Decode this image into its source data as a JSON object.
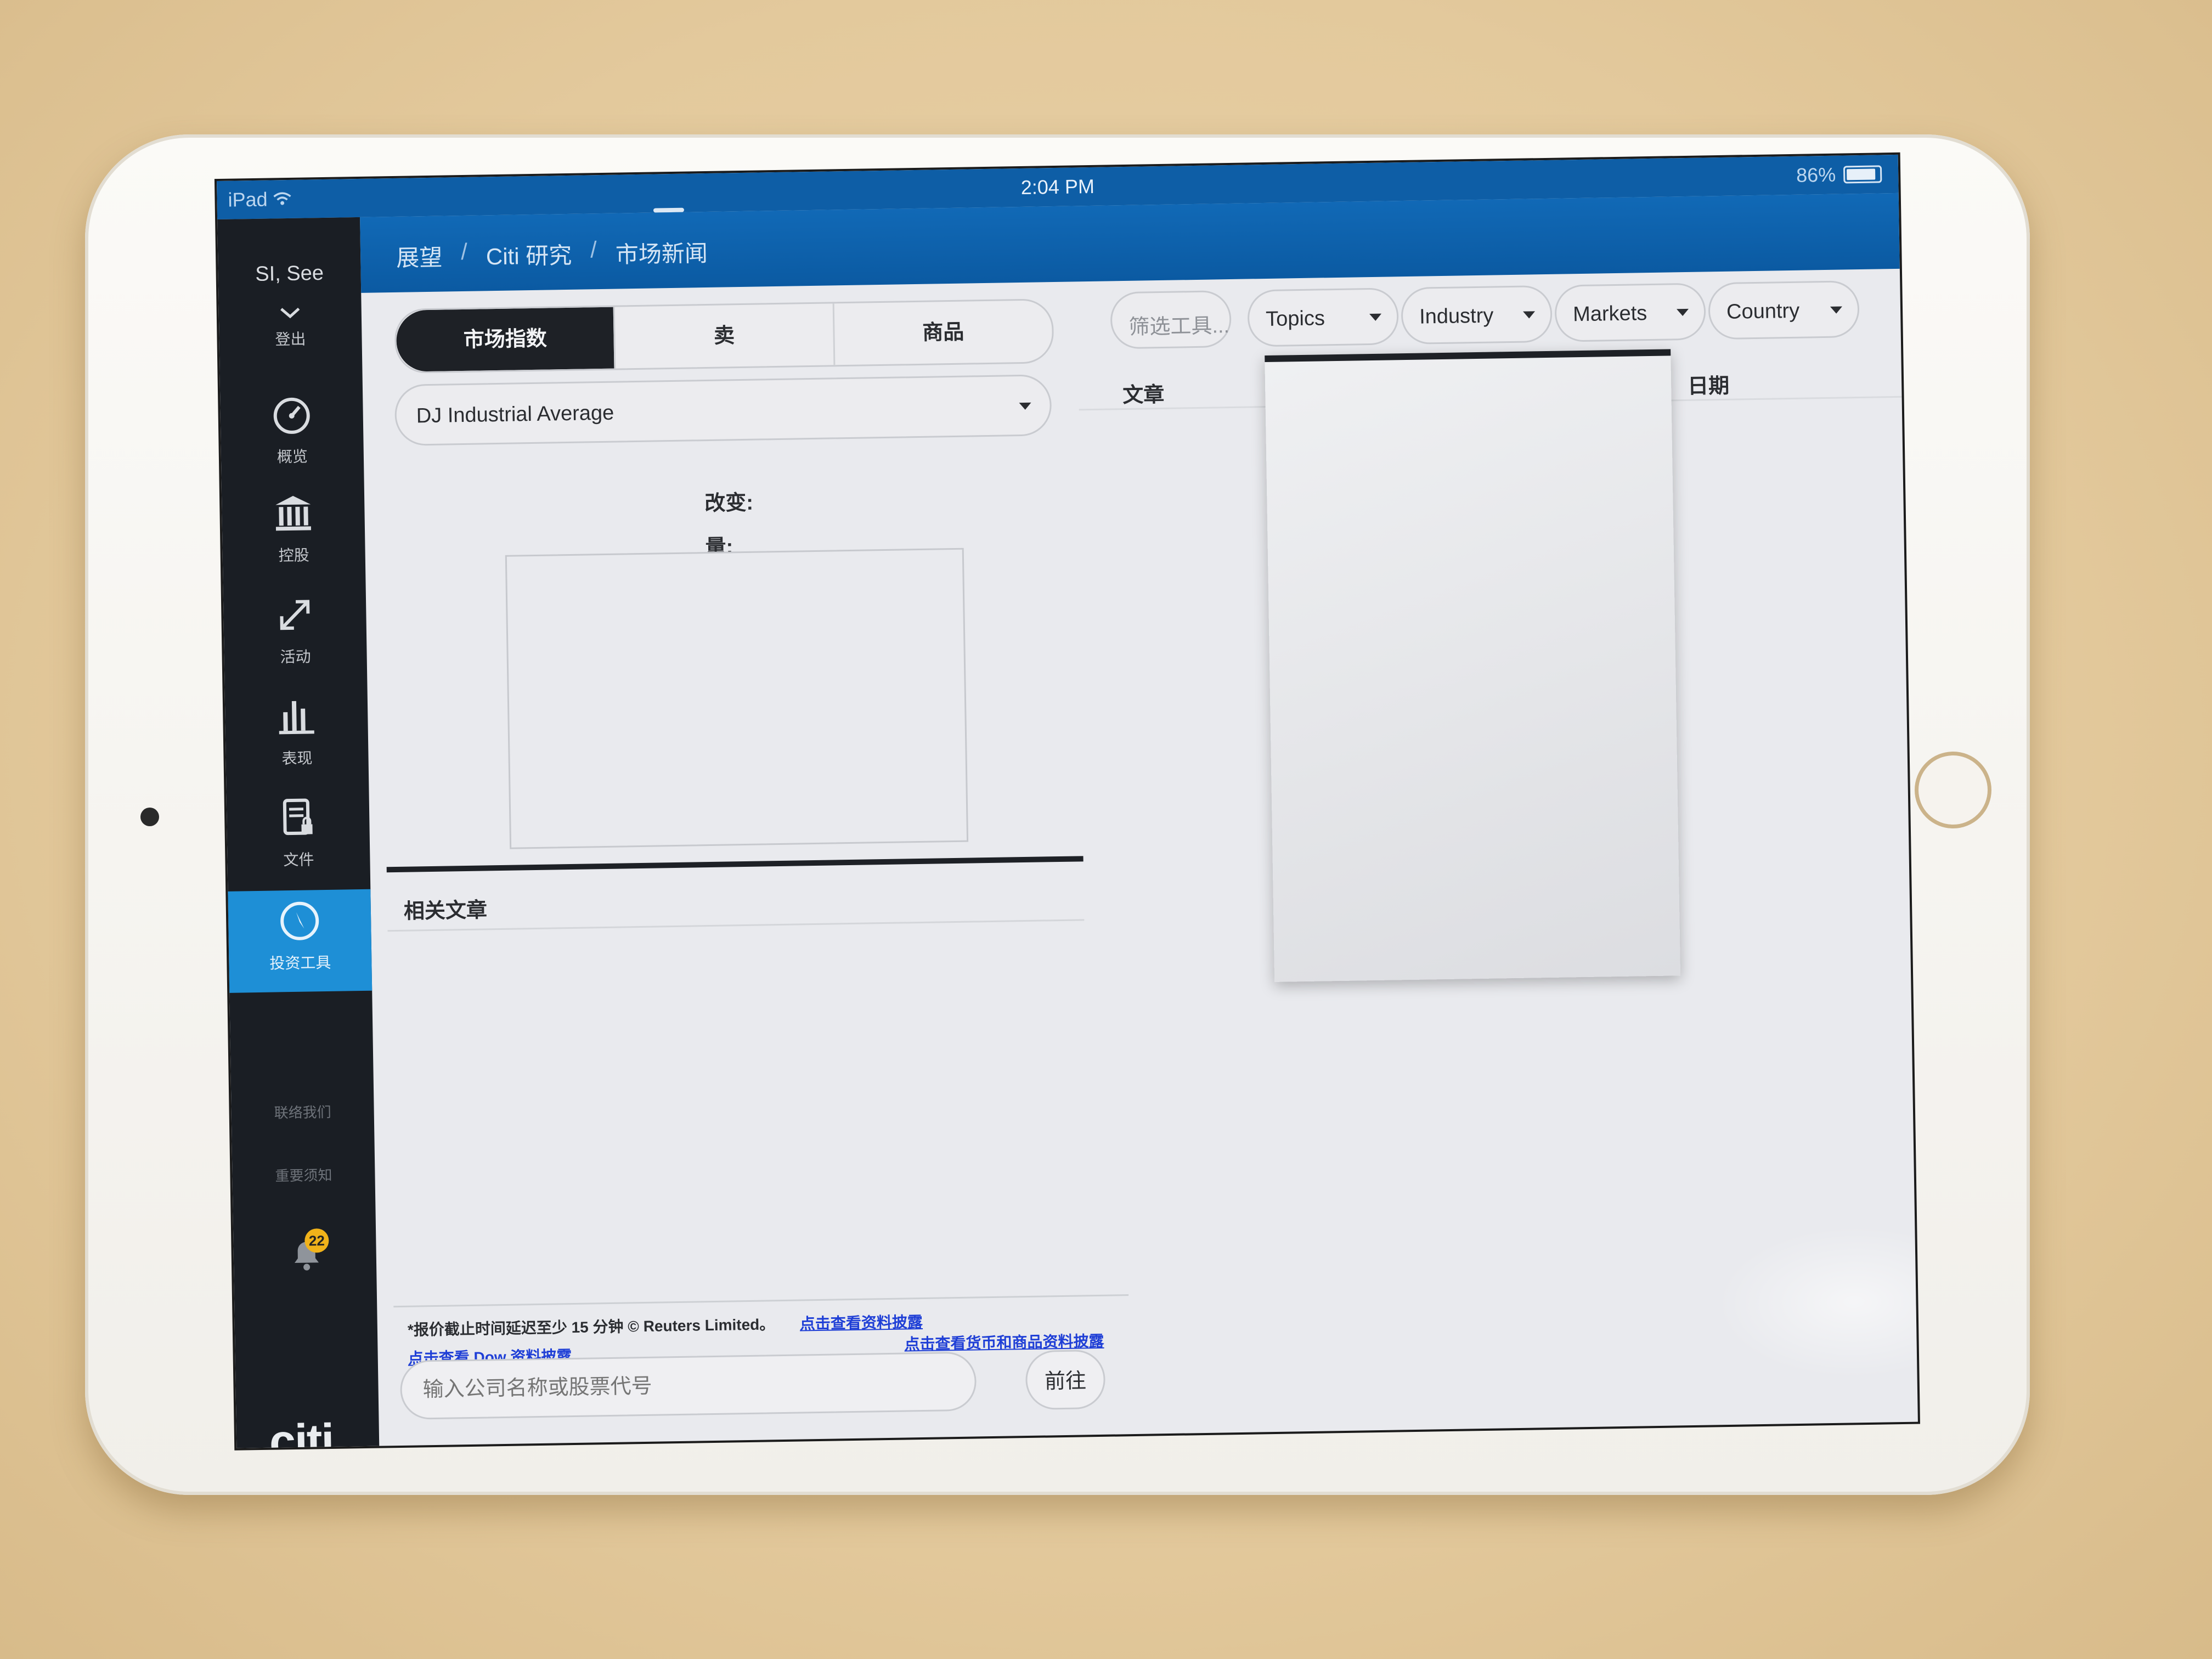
{
  "status_bar": {
    "device": "iPad",
    "time": "2:04 PM",
    "battery": "86%"
  },
  "sidebar": {
    "user_name": "SI, See",
    "logout_label": "登出",
    "items": [
      {
        "label": "概览",
        "icon": "speedometer-icon"
      },
      {
        "label": "控股",
        "icon": "bank-icon"
      },
      {
        "label": "活动",
        "icon": "transfer-arrows-icon"
      },
      {
        "label": "表现",
        "icon": "bar-chart-icon"
      },
      {
        "label": "文件",
        "icon": "document-lock-icon"
      },
      {
        "label": "投资工具",
        "icon": "compass-icon",
        "active": true
      }
    ],
    "contact_label": "联络我们",
    "notice_label": "重要须知",
    "notification_count": "22",
    "logo_text": "citi"
  },
  "header": {
    "breadcrumb": [
      "展望",
      "Citi 研究",
      "市场新闻"
    ],
    "separator": "/"
  },
  "left_panel": {
    "tabs": [
      "市场指数",
      "卖",
      "商品"
    ],
    "selected_index": "DJ Industrial Average",
    "change_label": "改变:",
    "volume_label": "量:",
    "related_articles_label": "相关文章"
  },
  "footer": {
    "disclaimer": "*报价截止时间延迟至少 15 分钟 © Reuters Limited。",
    "link_disclosure": "点击查看资料披露",
    "link_dow": "点击查看 Dow 资料披露",
    "link_fx": "点击查看货币和商品资料披露",
    "search_placeholder": "输入公司名称或股票代号",
    "go_label": "前往"
  },
  "right_panel": {
    "filter_placeholder": "筛选工具...",
    "filters": [
      "Topics",
      "Industry",
      "Markets",
      "Country"
    ],
    "col_article": "文章",
    "col_date": "日期"
  },
  "colors": {
    "header_blue": "#0b5aa2",
    "sidebar_dark": "#1a1e24",
    "active_blue": "#1e8fd6",
    "link_blue": "#1f3fd6",
    "badge_yellow": "#f0b21a"
  }
}
